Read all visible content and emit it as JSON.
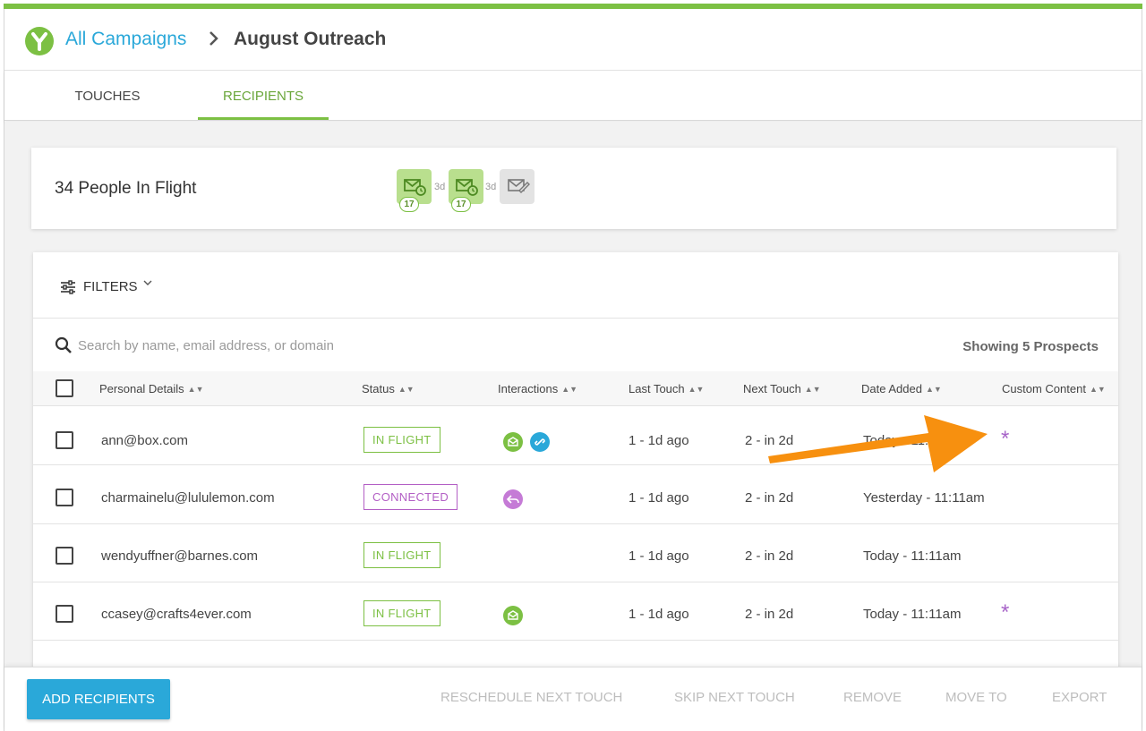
{
  "colors": {
    "accent_green": "#7cc043",
    "link_blue": "#2aa8d9",
    "connected_purple": "#b35fc5",
    "annotation_arrow": "#f7900f"
  },
  "header": {
    "logo_icon": "y-logo-icon",
    "breadcrumb_parent": "All Campaigns",
    "breadcrumb_separator": "›",
    "breadcrumb_current": "August Outreach"
  },
  "tabs": [
    {
      "label": "TOUCHES",
      "active": false
    },
    {
      "label": "RECIPIENTS",
      "active": true
    }
  ],
  "summary": {
    "people_in_flight": "34 People In Flight",
    "touches": [
      {
        "icon": "email-scheduled-icon",
        "count": "17",
        "state": "active"
      },
      {
        "delay": "3d"
      },
      {
        "icon": "email-scheduled-icon",
        "count": "17",
        "state": "active"
      },
      {
        "delay": "3d"
      },
      {
        "icon": "email-draft-icon",
        "state": "inactive"
      }
    ]
  },
  "filters": {
    "label": "FILTERS",
    "icon": "sliders-icon"
  },
  "search": {
    "placeholder": "Search by name, email address, or domain",
    "showing": "Showing 5 Prospects"
  },
  "table": {
    "columns": [
      "Personal Details",
      "Status",
      "Interactions",
      "Last Touch",
      "Next Touch",
      "Date Added",
      "Custom Content"
    ],
    "rows": [
      {
        "email": "ann@box.com",
        "status": "IN FLIGHT",
        "interactions": [
          "email-opened-icon",
          "link-clicked-icon"
        ],
        "last_touch": "1 - 1d ago",
        "next_touch": "2 - in 2d",
        "date_added": "Today - 11:",
        "custom_content": "*"
      },
      {
        "email": "charmainelu@lululemon.com",
        "status": "CONNECTED",
        "interactions": [
          "reply-icon"
        ],
        "last_touch": "1 - 1d ago",
        "next_touch": "2 - in 2d",
        "date_added": "Yesterday - 11:11am",
        "custom_content": ""
      },
      {
        "email": "wendyuffner@barnes.com",
        "status": "IN FLIGHT",
        "interactions": [],
        "last_touch": "1 - 1d ago",
        "next_touch": "2 - in 2d",
        "date_added": "Today - 11:11am",
        "custom_content": ""
      },
      {
        "email": "ccasey@crafts4ever.com",
        "status": "IN FLIGHT",
        "interactions": [
          "email-opened-icon"
        ],
        "last_touch": "1 - 1d ago",
        "next_touch": "2 - in 2d",
        "date_added": "Today - 11:11am",
        "custom_content": "*"
      }
    ]
  },
  "footer": {
    "add_recipients": "ADD RECIPIENTS",
    "reschedule": "RESCHEDULE NEXT TOUCH",
    "skip": "SKIP NEXT TOUCH",
    "remove": "REMOVE",
    "move_to": "MOVE TO",
    "export": "EXPORT"
  }
}
